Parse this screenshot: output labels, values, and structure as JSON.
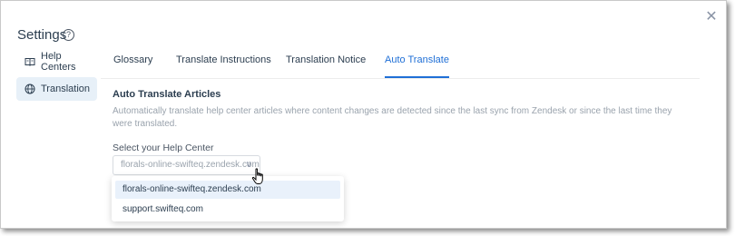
{
  "header": {
    "title": "Settings",
    "help_icon": "question-circle-icon",
    "close_icon": "close-icon"
  },
  "sidebar": {
    "items": [
      {
        "label": "Help Centers",
        "icon": "book-icon",
        "active": false
      },
      {
        "label": "Translation",
        "icon": "globe-icon",
        "active": true
      }
    ]
  },
  "tabs": [
    {
      "label": "Glossary",
      "active": false
    },
    {
      "label": "Translate Instructions",
      "active": false
    },
    {
      "label": "Translation Notice",
      "active": false
    },
    {
      "label": "Auto Translate",
      "active": true
    }
  ],
  "section": {
    "title": "Auto Translate Articles",
    "description": "Automatically translate help center articles where content changes are detected since the last sync from Zendesk or since the last time they were translated."
  },
  "help_center_select": {
    "label": "Select your Help Center",
    "placeholder": "florals-online-swifteq.zendesk.com",
    "options": [
      {
        "label": "florals-online-swifteq.zendesk.com",
        "highlighted": true
      },
      {
        "label": "support.swifteq.com",
        "highlighted": false
      }
    ]
  },
  "colors": {
    "accent": "#1f6fd6",
    "active_bg": "#e7f0f8",
    "text": "#2c3e50",
    "muted": "#9aa3ad"
  }
}
